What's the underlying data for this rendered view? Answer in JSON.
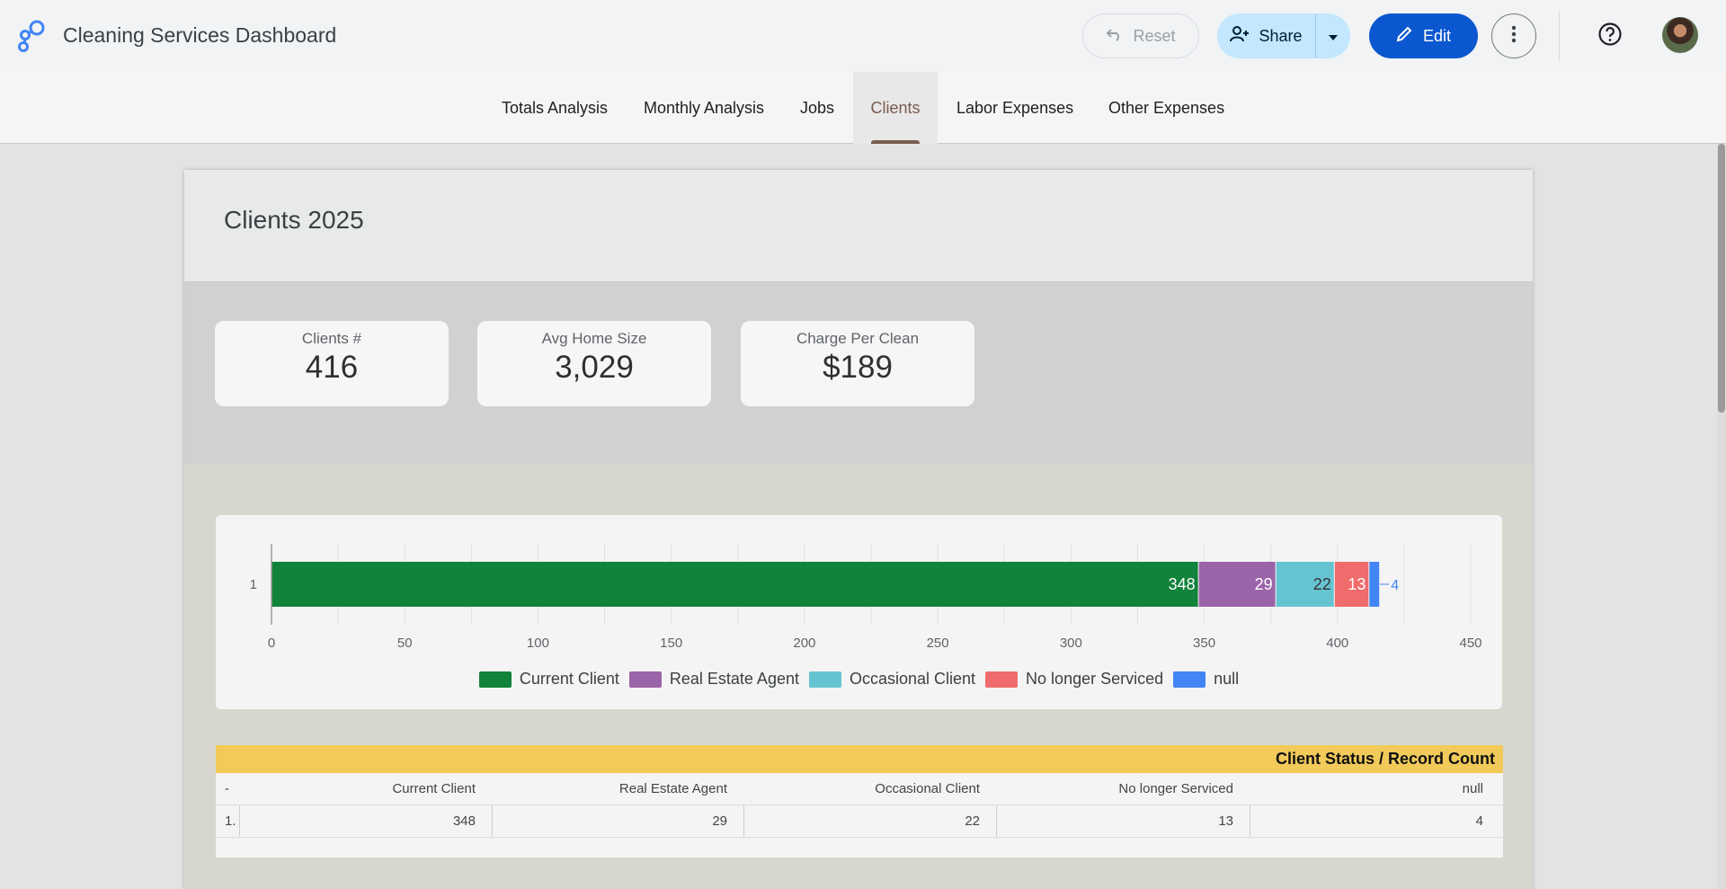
{
  "header": {
    "title": "Cleaning Services Dashboard",
    "reset_label": "Reset",
    "share_label": "Share",
    "edit_label": "Edit",
    "icons": {
      "logo": "looker-studio-logo-icon",
      "reset": "undo-icon",
      "share": "person-add-icon",
      "dropdown": "arrow-drop-down-icon",
      "edit": "pencil-icon",
      "more": "more-vert-icon",
      "help": "help-circle-icon"
    }
  },
  "nav": {
    "tabs": [
      {
        "label": "Totals Analysis"
      },
      {
        "label": "Monthly Analysis"
      },
      {
        "label": "Jobs"
      },
      {
        "label": "Clients",
        "active": true
      },
      {
        "label": "Labor Expenses"
      },
      {
        "label": "Other Expenses"
      }
    ],
    "active_color": "#7a5c4d"
  },
  "page": {
    "title": "Clients 2025"
  },
  "kpis": [
    {
      "label": "Clients #",
      "value": "416"
    },
    {
      "label": "Avg Home Size",
      "value": "3,029"
    },
    {
      "label": "Charge Per Clean",
      "value": "$189"
    }
  ],
  "chart_data": {
    "type": "bar",
    "orientation": "horizontal-stacked",
    "categories": [
      "1"
    ],
    "series": [
      {
        "name": "Current Client",
        "values": [
          348
        ],
        "color": "#11833a"
      },
      {
        "name": "Real Estate Agent",
        "values": [
          29
        ],
        "color": "#9b63a8"
      },
      {
        "name": "Occasional Client",
        "values": [
          22
        ],
        "color": "#66c4d2"
      },
      {
        "name": "No longer Serviced",
        "values": [
          13
        ],
        "color": "#f06b6b"
      },
      {
        "name": "null",
        "values": [
          4
        ],
        "color": "#4285f4"
      }
    ],
    "xlim": [
      0,
      450
    ],
    "x_ticks": [
      0,
      50,
      100,
      150,
      200,
      250,
      300,
      350,
      400,
      450
    ],
    "grid": true,
    "legend": "bottom"
  },
  "table": {
    "title": "Client Status / Record Count",
    "title_bg": "#f1ca5a",
    "index_header": "-",
    "columns": [
      "Current Client",
      "Real Estate Agent",
      "Occasional Client",
      "No longer Serviced",
      "null"
    ],
    "rows": [
      {
        "index": "1.",
        "values": [
          "348",
          "29",
          "22",
          "13",
          "4"
        ]
      }
    ]
  }
}
